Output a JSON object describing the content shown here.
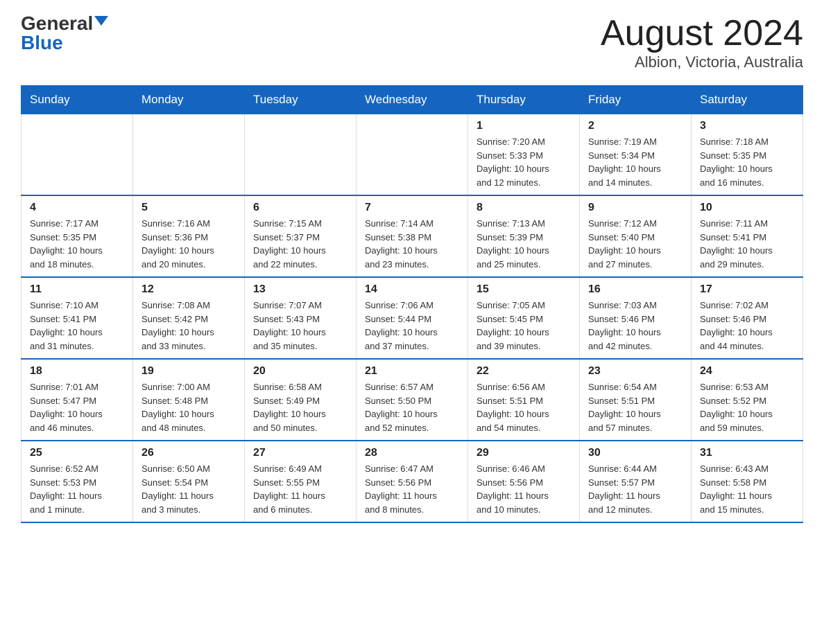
{
  "logo": {
    "general": "General",
    "blue": "Blue"
  },
  "title": "August 2024",
  "subtitle": "Albion, Victoria, Australia",
  "days_of_week": [
    "Sunday",
    "Monday",
    "Tuesday",
    "Wednesday",
    "Thursday",
    "Friday",
    "Saturday"
  ],
  "weeks": [
    [
      {
        "day": "",
        "info": ""
      },
      {
        "day": "",
        "info": ""
      },
      {
        "day": "",
        "info": ""
      },
      {
        "day": "",
        "info": ""
      },
      {
        "day": "1",
        "info": "Sunrise: 7:20 AM\nSunset: 5:33 PM\nDaylight: 10 hours\nand 12 minutes."
      },
      {
        "day": "2",
        "info": "Sunrise: 7:19 AM\nSunset: 5:34 PM\nDaylight: 10 hours\nand 14 minutes."
      },
      {
        "day": "3",
        "info": "Sunrise: 7:18 AM\nSunset: 5:35 PM\nDaylight: 10 hours\nand 16 minutes."
      }
    ],
    [
      {
        "day": "4",
        "info": "Sunrise: 7:17 AM\nSunset: 5:35 PM\nDaylight: 10 hours\nand 18 minutes."
      },
      {
        "day": "5",
        "info": "Sunrise: 7:16 AM\nSunset: 5:36 PM\nDaylight: 10 hours\nand 20 minutes."
      },
      {
        "day": "6",
        "info": "Sunrise: 7:15 AM\nSunset: 5:37 PM\nDaylight: 10 hours\nand 22 minutes."
      },
      {
        "day": "7",
        "info": "Sunrise: 7:14 AM\nSunset: 5:38 PM\nDaylight: 10 hours\nand 23 minutes."
      },
      {
        "day": "8",
        "info": "Sunrise: 7:13 AM\nSunset: 5:39 PM\nDaylight: 10 hours\nand 25 minutes."
      },
      {
        "day": "9",
        "info": "Sunrise: 7:12 AM\nSunset: 5:40 PM\nDaylight: 10 hours\nand 27 minutes."
      },
      {
        "day": "10",
        "info": "Sunrise: 7:11 AM\nSunset: 5:41 PM\nDaylight: 10 hours\nand 29 minutes."
      }
    ],
    [
      {
        "day": "11",
        "info": "Sunrise: 7:10 AM\nSunset: 5:41 PM\nDaylight: 10 hours\nand 31 minutes."
      },
      {
        "day": "12",
        "info": "Sunrise: 7:08 AM\nSunset: 5:42 PM\nDaylight: 10 hours\nand 33 minutes."
      },
      {
        "day": "13",
        "info": "Sunrise: 7:07 AM\nSunset: 5:43 PM\nDaylight: 10 hours\nand 35 minutes."
      },
      {
        "day": "14",
        "info": "Sunrise: 7:06 AM\nSunset: 5:44 PM\nDaylight: 10 hours\nand 37 minutes."
      },
      {
        "day": "15",
        "info": "Sunrise: 7:05 AM\nSunset: 5:45 PM\nDaylight: 10 hours\nand 39 minutes."
      },
      {
        "day": "16",
        "info": "Sunrise: 7:03 AM\nSunset: 5:46 PM\nDaylight: 10 hours\nand 42 minutes."
      },
      {
        "day": "17",
        "info": "Sunrise: 7:02 AM\nSunset: 5:46 PM\nDaylight: 10 hours\nand 44 minutes."
      }
    ],
    [
      {
        "day": "18",
        "info": "Sunrise: 7:01 AM\nSunset: 5:47 PM\nDaylight: 10 hours\nand 46 minutes."
      },
      {
        "day": "19",
        "info": "Sunrise: 7:00 AM\nSunset: 5:48 PM\nDaylight: 10 hours\nand 48 minutes."
      },
      {
        "day": "20",
        "info": "Sunrise: 6:58 AM\nSunset: 5:49 PM\nDaylight: 10 hours\nand 50 minutes."
      },
      {
        "day": "21",
        "info": "Sunrise: 6:57 AM\nSunset: 5:50 PM\nDaylight: 10 hours\nand 52 minutes."
      },
      {
        "day": "22",
        "info": "Sunrise: 6:56 AM\nSunset: 5:51 PM\nDaylight: 10 hours\nand 54 minutes."
      },
      {
        "day": "23",
        "info": "Sunrise: 6:54 AM\nSunset: 5:51 PM\nDaylight: 10 hours\nand 57 minutes."
      },
      {
        "day": "24",
        "info": "Sunrise: 6:53 AM\nSunset: 5:52 PM\nDaylight: 10 hours\nand 59 minutes."
      }
    ],
    [
      {
        "day": "25",
        "info": "Sunrise: 6:52 AM\nSunset: 5:53 PM\nDaylight: 11 hours\nand 1 minute."
      },
      {
        "day": "26",
        "info": "Sunrise: 6:50 AM\nSunset: 5:54 PM\nDaylight: 11 hours\nand 3 minutes."
      },
      {
        "day": "27",
        "info": "Sunrise: 6:49 AM\nSunset: 5:55 PM\nDaylight: 11 hours\nand 6 minutes."
      },
      {
        "day": "28",
        "info": "Sunrise: 6:47 AM\nSunset: 5:56 PM\nDaylight: 11 hours\nand 8 minutes."
      },
      {
        "day": "29",
        "info": "Sunrise: 6:46 AM\nSunset: 5:56 PM\nDaylight: 11 hours\nand 10 minutes."
      },
      {
        "day": "30",
        "info": "Sunrise: 6:44 AM\nSunset: 5:57 PM\nDaylight: 11 hours\nand 12 minutes."
      },
      {
        "day": "31",
        "info": "Sunrise: 6:43 AM\nSunset: 5:58 PM\nDaylight: 11 hours\nand 15 minutes."
      }
    ]
  ]
}
